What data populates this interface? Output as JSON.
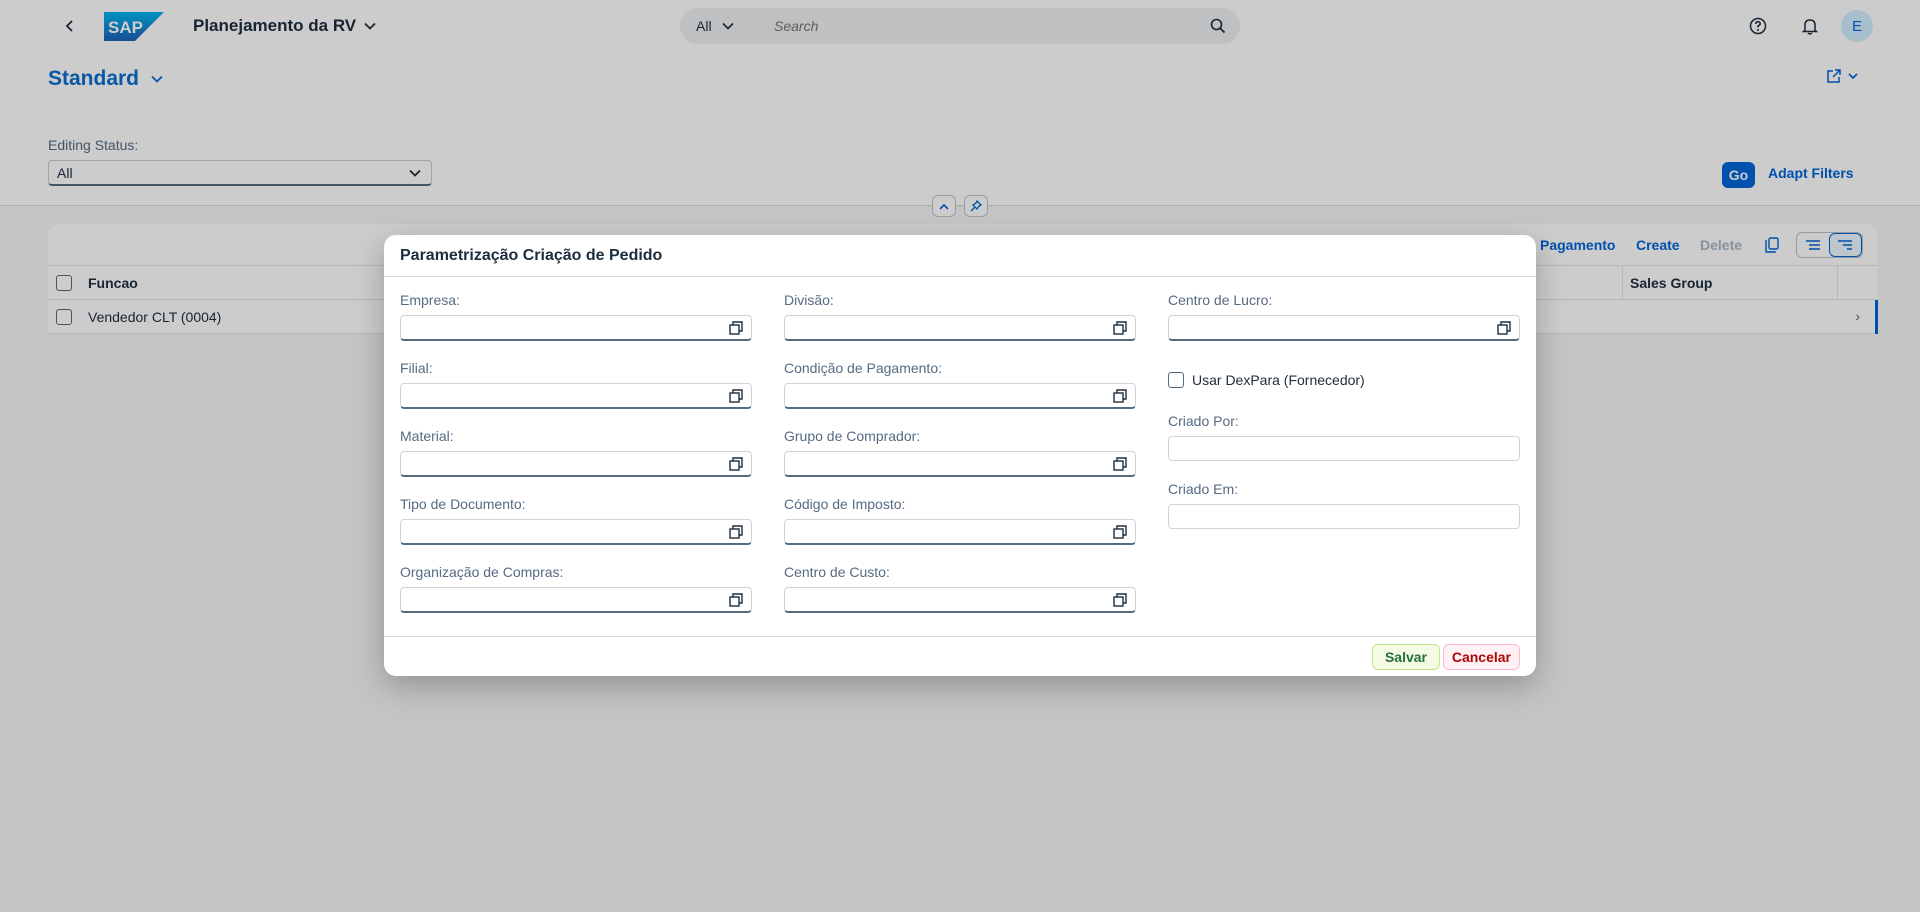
{
  "shell": {
    "app_title": "Planejamento da RV",
    "search_scope": "All",
    "search_placeholder": "Search",
    "avatar_initial": "E",
    "logo_text": "SAP"
  },
  "header": {
    "variant": "Standard",
    "filter_label": "Editing Status:",
    "filter_value": "All",
    "go_label": "Go",
    "adapt_label": "Adapt Filters"
  },
  "table": {
    "toolbar": {
      "partial_button": "Pagamento",
      "create": "Create",
      "delete": "Delete"
    },
    "columns": {
      "funcao": "Funcao",
      "sales_group": "Sales Group"
    },
    "rows": [
      {
        "funcao": "Vendedor CLT (0004)"
      }
    ]
  },
  "dialog": {
    "title": "Parametrização Criação de Pedido",
    "col1": [
      "Empresa:",
      "Filial:",
      "Material:",
      "Tipo de Documento:",
      "Organização de Compras:"
    ],
    "col2": [
      "Divisão:",
      "Condição de Pagamento:",
      "Grupo de Comprador:",
      "Código de Imposto:",
      "Centro de Custo:"
    ],
    "col3": {
      "centro_lucro": "Centro de Lucro:",
      "checkbox": "Usar DexPara (Fornecedor)",
      "criado_por": "Criado Por:",
      "criado_em": "Criado Em:"
    },
    "save": "Salvar",
    "cancel": "Cancelar"
  },
  "colors": {
    "brand": "#0064d9",
    "variant_title": "#0a6ed1",
    "save_text": "#256f3a",
    "cancel_text": "#aa0808"
  }
}
